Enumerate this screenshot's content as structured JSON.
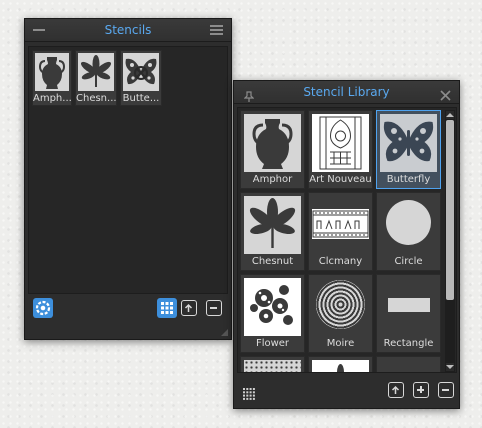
{
  "stencils_panel": {
    "title": "Stencils",
    "items": [
      {
        "label": "Amph..."
      },
      {
        "label": "Chesn..."
      },
      {
        "label": "Butte..."
      }
    ]
  },
  "library_panel": {
    "title": "Stencil Library",
    "items": [
      {
        "label": "Amphor"
      },
      {
        "label": "Art Nouveau"
      },
      {
        "label": "Butterfly"
      },
      {
        "label": "Chesnut"
      },
      {
        "label": "Clcmany"
      },
      {
        "label": "Circle"
      },
      {
        "label": "Flower"
      },
      {
        "label": "Moire"
      },
      {
        "label": "Rectangle"
      }
    ],
    "selected_item": "Butterfly"
  },
  "colors": {
    "accent": "#5aa9f0",
    "panel_bg": "#2d2d2d",
    "selection_border": "#4fa3f0"
  },
  "icons": [
    "minimize-icon",
    "hamburger-menu-icon",
    "pin-icon",
    "close-icon",
    "gear-icon",
    "grid-view-icon",
    "import-icon",
    "add-icon",
    "remove-icon",
    "resize-grip-icon"
  ]
}
